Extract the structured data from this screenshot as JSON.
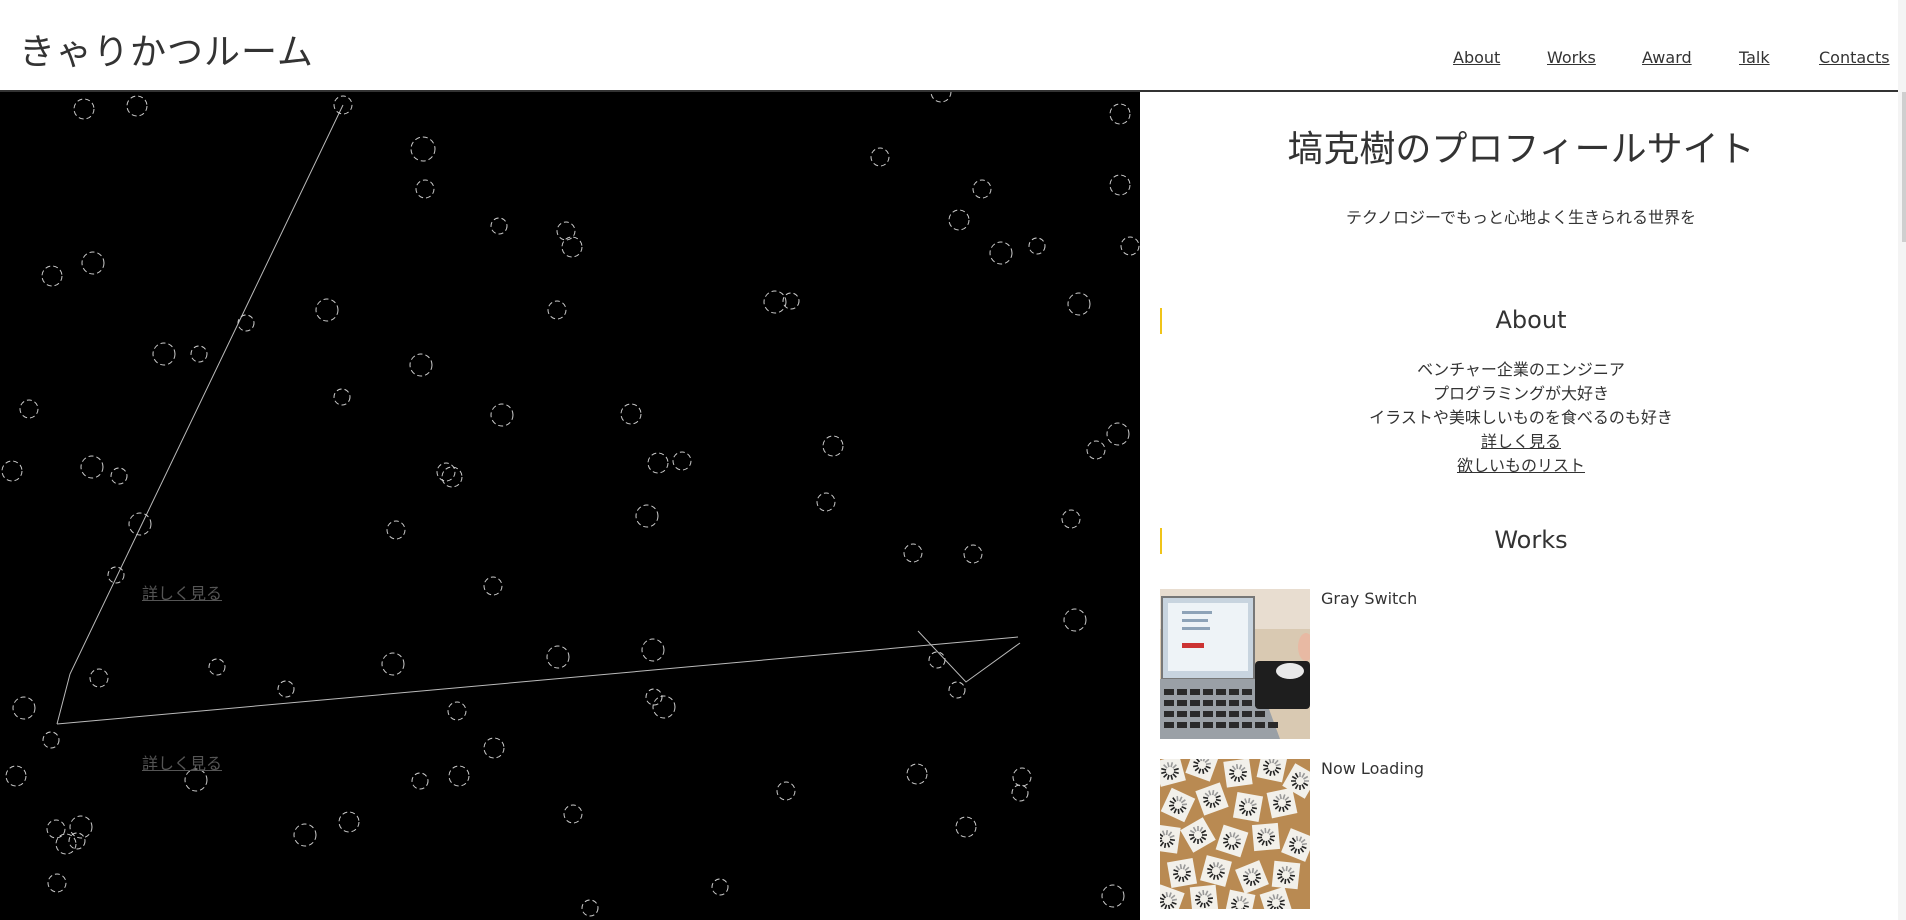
{
  "header": {
    "site_title": "きゃりかつルーム",
    "nav": [
      "About",
      "Works",
      "Award",
      "Talk",
      "Contacts"
    ]
  },
  "canvas": {
    "links": [
      "詳しく見る",
      "詳しく見る"
    ]
  },
  "profile": {
    "title": "塙克樹のプロフィールサイト",
    "tagline": "テクノロジーでもっと心地よく生きられる世界を"
  },
  "about": {
    "heading": "About",
    "lines": [
      "ベンチャー企業のエンジニア",
      "プログラミングが大好き",
      "イラストや美味しいものを食べるのも好き"
    ],
    "more_link": "詳しく見る",
    "wishlist_link": "欲しいものリスト"
  },
  "works": {
    "heading": "Works",
    "items": [
      {
        "title": "Gray Switch"
      },
      {
        "title": "Now Loading"
      }
    ]
  },
  "colors": {
    "accent": "#f0c419",
    "canvas_bg": "#000000",
    "text": "#333333"
  }
}
